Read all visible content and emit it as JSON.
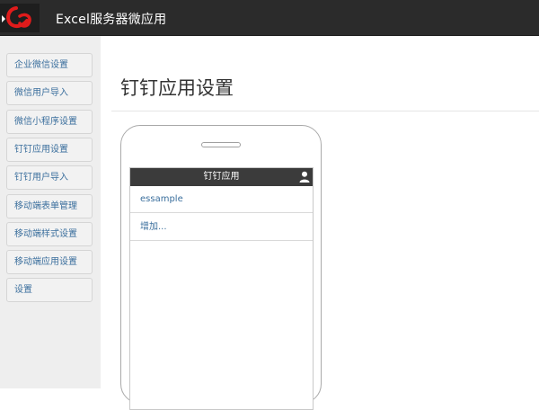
{
  "header": {
    "title": "Excel服务器微应用"
  },
  "sidebar": {
    "items": [
      {
        "label": "企业微信设置"
      },
      {
        "label": "微信用户导入"
      },
      {
        "label": "微信小程序设置"
      },
      {
        "label": "钉钉应用设置"
      },
      {
        "label": "钉钉用户导入"
      },
      {
        "label": "移动端表单管理"
      },
      {
        "label": "移动端样式设置"
      },
      {
        "label": "移动端应用设置"
      },
      {
        "label": "设置"
      }
    ]
  },
  "main": {
    "title": "钉钉应用设置",
    "phone": {
      "header_title": "钉钉应用",
      "items": [
        {
          "label": "essample"
        },
        {
          "label": "增加..."
        }
      ]
    }
  },
  "icons": {
    "logo": "app-logo-icon",
    "user": "user-icon"
  },
  "colors": {
    "topbar": "#2b2b2b",
    "link": "#3b6f9d",
    "sidebar_bg": "#eeeeee"
  }
}
